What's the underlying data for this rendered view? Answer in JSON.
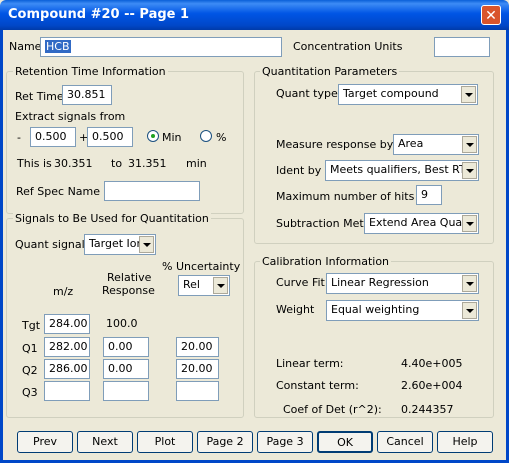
{
  "window": {
    "title": "Compound #20  -- Page 1",
    "close": "✕"
  },
  "top": {
    "name_label": "Name",
    "name_value": "HCB",
    "conc_label": "Concentration Units",
    "conc_value": ""
  },
  "retention": {
    "title": "Retention Time Information",
    "ret_time_label": "Ret Time",
    "ret_time_value": "30.851",
    "extract_label": "Extract signals from",
    "minus": "-",
    "minus_value": "0.500",
    "plus": "+",
    "plus_value": "0.500",
    "radio_min": "Min",
    "radio_pct": "%",
    "this_is": "This is",
    "from_value": "30.351",
    "to": "to",
    "to_value": "31.351",
    "unit": "min",
    "ref_spec_label": "Ref Spec Name",
    "ref_spec_value": ""
  },
  "signals": {
    "title": "Signals to Be Used for Quantitation",
    "quant_signal_label": "Quant signal",
    "quant_signal_value": "Target Ion",
    "pct_uncertainty": "% Uncertainty",
    "uncertainty_value": "Rel",
    "mz": "m/z",
    "relative": "Relative",
    "response": "Response",
    "rows": [
      {
        "label": "Tgt",
        "mz": "284.00",
        "resp": "100.0",
        "unc": ""
      },
      {
        "label": "Q1",
        "mz": "282.00",
        "resp": "0.00",
        "unc": "20.00"
      },
      {
        "label": "Q2",
        "mz": "286.00",
        "resp": "0.00",
        "unc": "20.00"
      },
      {
        "label": "Q3",
        "mz": "",
        "resp": "",
        "unc": ""
      }
    ]
  },
  "quant": {
    "title": "Quantitation Parameters",
    "quant_type_label": "Quant type",
    "quant_type_value": "Target compound",
    "measure_label": "Measure response by",
    "measure_value": "Area",
    "ident_label": "Ident by",
    "ident_value": "Meets qualifiers, Best RT",
    "max_hits_label": "Maximum number of hits",
    "max_hits_value": "9",
    "subtraction_label": "Subtraction Meth.",
    "subtraction_value": "Extend Area Quant"
  },
  "calibration": {
    "title": "Calibration Information",
    "curve_fit_label": "Curve Fit",
    "curve_fit_value": "Linear Regression",
    "weight_label": "Weight",
    "weight_value": "Equal weighting",
    "linear_label": "Linear term:",
    "linear_value": "4.40e+005",
    "constant_label": "Constant term:",
    "constant_value": "2.60e+004",
    "coef_label": "Coef of Det (r^2):",
    "coef_value": "0.244357"
  },
  "buttons": {
    "prev": "Prev",
    "next": "Next",
    "plot": "Plot",
    "page2": "Page 2",
    "page3": "Page 3",
    "ok": "OK",
    "cancel": "Cancel",
    "help": "Help"
  }
}
